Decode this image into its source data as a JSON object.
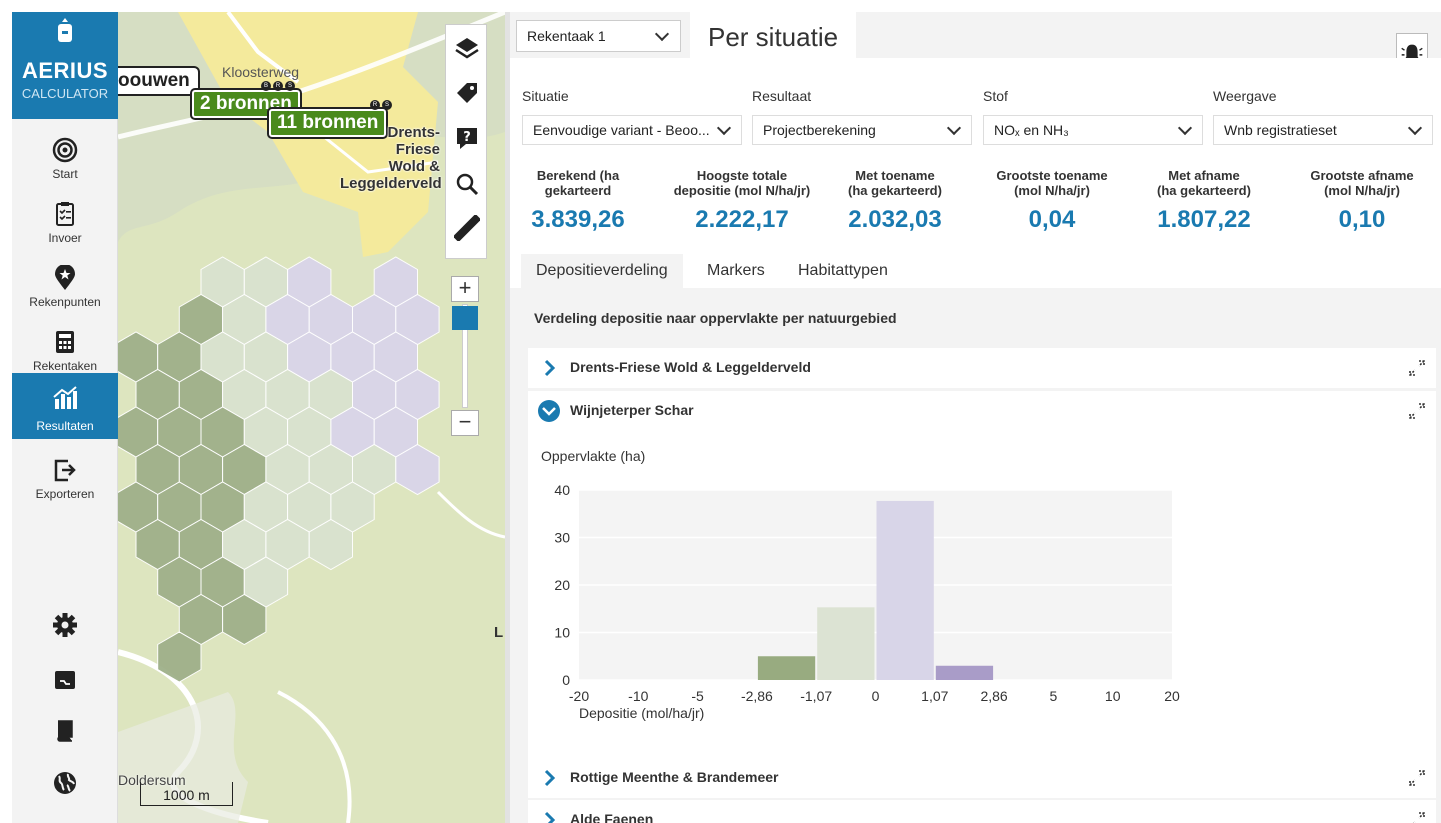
{
  "app": {
    "logo_name": "AERIUS",
    "logo_sub": "CALCULATOR",
    "nav": [
      {
        "label": "Start",
        "icon": "target-icon"
      },
      {
        "label": "Invoer",
        "icon": "clipboard-icon"
      },
      {
        "label": "Rekenpunten",
        "icon": "map-pin-star-icon"
      },
      {
        "label": "Rekentaken",
        "icon": "calculator-icon"
      },
      {
        "label": "Resultaten",
        "icon": "results-chart-icon",
        "active": true
      },
      {
        "label": "Exporteren",
        "icon": "export-icon"
      }
    ],
    "nav_bottom_icons": [
      "gear-icon",
      "terminal-icon",
      "book-icon",
      "globe-icon"
    ]
  },
  "map": {
    "tag_partial": "oouwen",
    "tag_sources_1": "2 bronnen",
    "tag_sources_2": "11 bronnen",
    "badges_1": [
      "B",
      "R",
      "S"
    ],
    "badges_2": [
      "R",
      "S"
    ],
    "place_top": "Kloosterweg",
    "area_label": "Drents-\nFriese\nWold &\nLeggelderveld",
    "place_bottom": "Doldersum",
    "edge_letter": "L",
    "scale_label": "1000 m",
    "tools": [
      "layers-icon",
      "tag-icon",
      "help-icon",
      "search-icon",
      "ruler-icon"
    ],
    "zoom_in": "+",
    "zoom_out": "−"
  },
  "panel": {
    "calc_select": "Rekentaak 1",
    "title": "Per situatie",
    "fields": [
      {
        "label": "Situatie",
        "value": "Eenvoudige variant - Beoo..."
      },
      {
        "label": "Resultaat",
        "value": "Projectberekening"
      },
      {
        "label": "Stof",
        "value": "NOₓ en NH₃"
      },
      {
        "label": "Weergave",
        "value": "Wnb registratieset"
      }
    ],
    "stats": [
      {
        "header": "Berekend (ha\ngekarteerd",
        "value": "3.839,26"
      },
      {
        "header": "Hoogste totale\ndepositie (mol N/ha/jr)",
        "value": "2.222,17"
      },
      {
        "header": "Met toename\n(ha gekarteerd)",
        "value": "2.032,03"
      },
      {
        "header": "Grootste toename\n(mol N/ha/jr)",
        "value": "0,04"
      },
      {
        "header": "Met afname\n(ha gekarteerd)",
        "value": "1.807,22"
      },
      {
        "header": "Grootste afname\n(mol N/ha/jr)",
        "value": "0,10"
      }
    ],
    "tabs": [
      "Depositieverdeling",
      "Markers",
      "Habitattypen"
    ],
    "dist_title": "Verdeling depositie naar oppervlakte per natuurgebied",
    "areas": [
      {
        "name": "Drents-Friese Wold & Leggelderveld",
        "expanded": false
      },
      {
        "name": "Wijnjeterper Schar",
        "expanded": true
      },
      {
        "name": "Rottige Meenthe & Brandemeer",
        "expanded": false
      },
      {
        "name": "Alde Faenen",
        "expanded": false
      }
    ]
  },
  "chart_data": {
    "type": "bar",
    "ylabel": "Oppervlakte (ha)",
    "xlabel": "Depositie (mol/ha/jr)",
    "x_ticks": [
      "-20",
      "-10",
      "-5",
      "-2,86",
      "-1,07",
      "0",
      "1,07",
      "2,86",
      "5",
      "10",
      "20"
    ],
    "y_ticks": [
      "0",
      "10",
      "20",
      "30",
      "40"
    ],
    "ylim": [
      0,
      40
    ],
    "bins": [
      {
        "from": "-20",
        "to": "-10",
        "value": 0,
        "color": "#8fa67a"
      },
      {
        "from": "-10",
        "to": "-5",
        "value": 0,
        "color": "#8fa67a"
      },
      {
        "from": "-5",
        "to": "-2,86",
        "value": 0,
        "color": "#8fa67a"
      },
      {
        "from": "-2,86",
        "to": "-1,07",
        "value": 5,
        "color": "#98ab80"
      },
      {
        "from": "-1,07",
        "to": "0",
        "value": 15.3,
        "color": "#dce3d3"
      },
      {
        "from": "0",
        "to": "1,07",
        "value": 37.7,
        "color": "#d8d5e8"
      },
      {
        "from": "1,07",
        "to": "2,86",
        "value": 3,
        "color": "#a99cc8"
      },
      {
        "from": "2,86",
        "to": "5",
        "value": 0,
        "color": "#a99cc8"
      },
      {
        "from": "5",
        "to": "10",
        "value": 0,
        "color": "#a99cc8"
      },
      {
        "from": "10",
        "to": "20",
        "value": 0,
        "color": "#a99cc8"
      }
    ],
    "grid": true
  }
}
